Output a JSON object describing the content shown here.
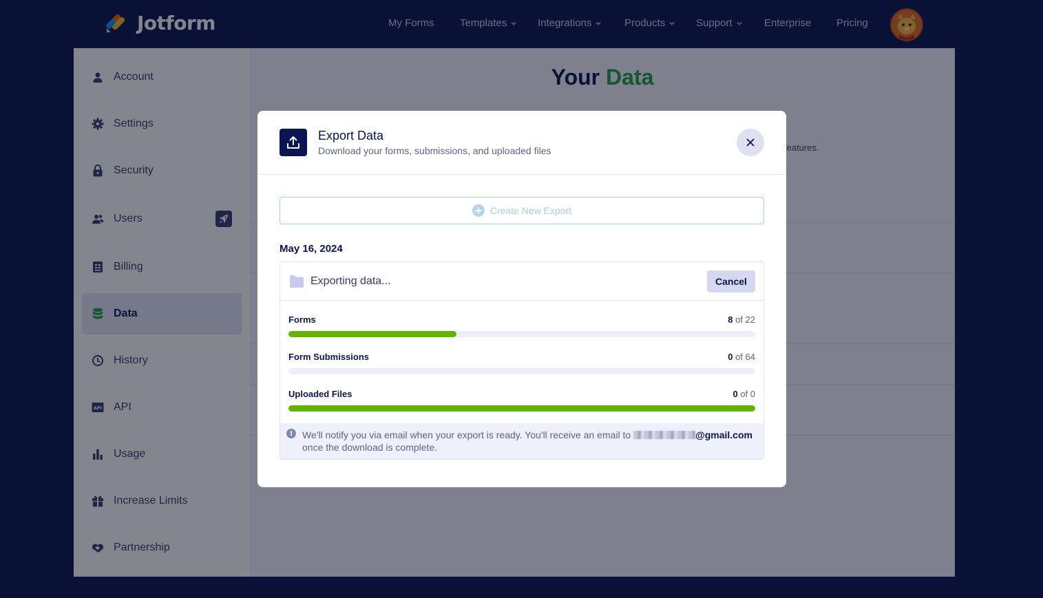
{
  "nav": {
    "brand": "Jotform",
    "items": [
      {
        "label": "My Forms",
        "dropdown": false
      },
      {
        "label": "Templates",
        "dropdown": true
      },
      {
        "label": "Integrations",
        "dropdown": true
      },
      {
        "label": "Products",
        "dropdown": true
      },
      {
        "label": "Support",
        "dropdown": true
      },
      {
        "label": "Enterprise",
        "dropdown": false
      },
      {
        "label": "Pricing",
        "dropdown": false
      }
    ]
  },
  "sidebar": {
    "items": [
      {
        "label": "Account",
        "icon": "user-icon"
      },
      {
        "label": "Settings",
        "icon": "gear-icon"
      },
      {
        "label": "Security",
        "icon": "lock-icon"
      },
      {
        "label": "Users",
        "icon": "users-icon"
      },
      {
        "label": "Billing",
        "icon": "billing-icon"
      },
      {
        "label": "Data",
        "icon": "database-icon",
        "active": true
      },
      {
        "label": "History",
        "icon": "history-icon"
      },
      {
        "label": "API",
        "icon": "api-icon"
      },
      {
        "label": "Usage",
        "icon": "bar-chart-icon"
      },
      {
        "label": "Increase Limits",
        "icon": "gift-icon"
      },
      {
        "label": "Partnership",
        "icon": "handshake-icon"
      }
    ]
  },
  "main": {
    "title_prefix": "Your",
    "title_accent": "Data",
    "partial_text": "features."
  },
  "modal": {
    "title": "Export Data",
    "subtitle": "Download your forms, submissions, and uploaded files",
    "create_label": "Create New Export",
    "date": "May 16, 2024",
    "status": "Exporting data...",
    "cancel_label": "Cancel",
    "progress": [
      {
        "label": "Forms",
        "current": "8",
        "total": "of 22",
        "fraction": 0.36
      },
      {
        "label": "Form Submissions",
        "current": "0",
        "total": "of 64",
        "fraction": 0.0
      },
      {
        "label": "Uploaded Files",
        "current": "0",
        "total": "of 0",
        "fraction": 1.0
      }
    ],
    "notice_before": "We'll notify you via email when your export is ready. You'll receive an email to ",
    "notice_domain": "@gmail.com",
    "notice_after": "once the download is complete."
  },
  "colors": {
    "nav_bg": "#0a1551",
    "accent_green": "#1f9e43",
    "progress_green": "#64b200"
  }
}
